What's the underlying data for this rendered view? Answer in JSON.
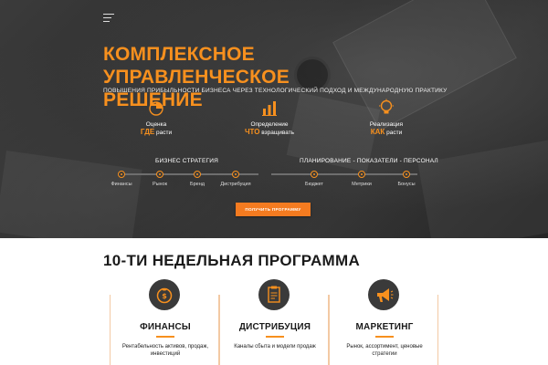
{
  "hero": {
    "title_line1": "КОМПЛЕКСНОЕ УПРАВЛЕНЧЕСКОЕ",
    "title_line2": "РЕШЕНИЕ",
    "subtitle": "ПОВЫШЕНИЯ ПРИБЫЛЬНОСТИ БИЗНЕСА ЧЕРЕЗ ТЕХНОЛОГИЧЕСКИЙ ПОДХОД И МЕЖДУНАРОДНУЮ ПРАКТИКУ",
    "features": [
      {
        "icon": "pie-chart-icon",
        "line1": "Оценка",
        "accent": "ГДЕ",
        "rest": " расти"
      },
      {
        "icon": "bar-chart-icon",
        "line1": "Определение",
        "accent": "ЧТО",
        "rest": " взращивать"
      },
      {
        "icon": "lightbulb-icon",
        "line1": "Реализация",
        "accent": "КАК",
        "rest": " расти"
      }
    ],
    "groups": [
      {
        "label": "БИЗНЕС СТРАТЕГИЯ",
        "steps": [
          "Финансы",
          "Рынок",
          "Бренд",
          "Дистрибуция"
        ]
      },
      {
        "label": "ПЛАНИРОВАНИЕ - ПОКАЗАТЕЛИ - ПЕРСОНАЛ",
        "steps": [
          "Бюджет",
          "Метрики",
          "Бонусы"
        ]
      }
    ],
    "cta_label": "ПОЛУЧИТЬ ПРОГРАММУ"
  },
  "program": {
    "title": "10-ТИ НЕДЕЛЬНАЯ ПРОГРАММА",
    "cards": [
      {
        "icon": "money-bag-icon",
        "title": "ФИНАНСЫ",
        "desc": "Рентабельность активов, продаж, инвестиций"
      },
      {
        "icon": "clipboard-icon",
        "title": "ДИСТРИБУЦИЯ",
        "desc": "Каналы сбыта и модели продаж"
      },
      {
        "icon": "megaphone-icon",
        "title": "МАРКЕТИНГ",
        "desc": "Рынок, ассортимент, ценовые стратегии"
      }
    ]
  },
  "colors": {
    "accent": "#f7901e",
    "dark": "#2f2f2f"
  }
}
